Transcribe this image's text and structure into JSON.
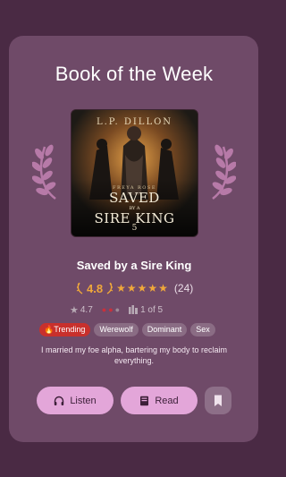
{
  "section_title": "Book of the Week",
  "cover": {
    "author": "L.P. DILLON",
    "series_line": "FREYA ROSE",
    "title_line1": "SAVED",
    "title_line2": "BY A",
    "title_line3": "SIRE KING",
    "number": "5"
  },
  "book": {
    "title": "Saved by a Sire King",
    "rating": "4.8",
    "stars": 5,
    "rating_count": "(24)",
    "user_score": "4.7",
    "heat_level": 2,
    "heat_max": 3,
    "series_position": "1 of 5",
    "description": "I married my foe alpha, bartering my body to reclaim everything."
  },
  "tags": [
    {
      "label": "Trending",
      "type": "trending"
    },
    {
      "label": "Werewolf",
      "type": "normal"
    },
    {
      "label": "Dominant",
      "type": "normal"
    },
    {
      "label": "Sex",
      "type": "normal"
    }
  ],
  "actions": {
    "listen_label": "Listen",
    "read_label": "Read"
  },
  "colors": {
    "background": "#4a2a44",
    "card": "#6f4a68",
    "accent_button": "#e3a6d9",
    "star": "#f0a83a",
    "trending": "#c8302c"
  },
  "icons": [
    "laurel-left-icon",
    "laurel-right-icon",
    "headphones-icon",
    "book-icon",
    "bookmark-icon",
    "star-icon",
    "pepper-icon",
    "books-icon",
    "fire-icon"
  ]
}
